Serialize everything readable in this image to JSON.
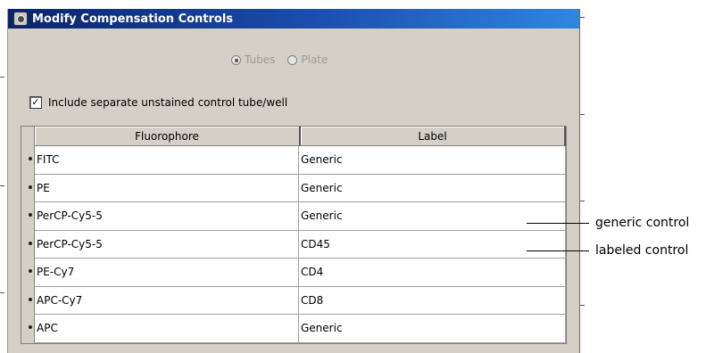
{
  "window": {
    "title": "Modify Compensation Controls",
    "icon": "app-camera-icon"
  },
  "source_type": {
    "options": [
      {
        "label": "Tubes",
        "selected": true
      },
      {
        "label": "Plate",
        "selected": false
      }
    ],
    "disabled": true
  },
  "unstained_control": {
    "label": "Include separate unstained control tube/well",
    "checked": true
  },
  "table": {
    "columns": [
      "Fluorophore",
      "Label"
    ],
    "rows": [
      {
        "fluorophore": "FITC",
        "label": "Generic"
      },
      {
        "fluorophore": "PE",
        "label": "Generic"
      },
      {
        "fluorophore": "PerCP-Cy5-5",
        "label": "Generic"
      },
      {
        "fluorophore": "PerCP-Cy5-5",
        "label": "CD45"
      },
      {
        "fluorophore": "PE-Cy7",
        "label": "CD4"
      },
      {
        "fluorophore": "APC-Cy7",
        "label": "CD8"
      },
      {
        "fluorophore": "APC",
        "label": "Generic"
      }
    ]
  },
  "callouts": {
    "generic": "generic control",
    "labeled": "labeled control"
  }
}
